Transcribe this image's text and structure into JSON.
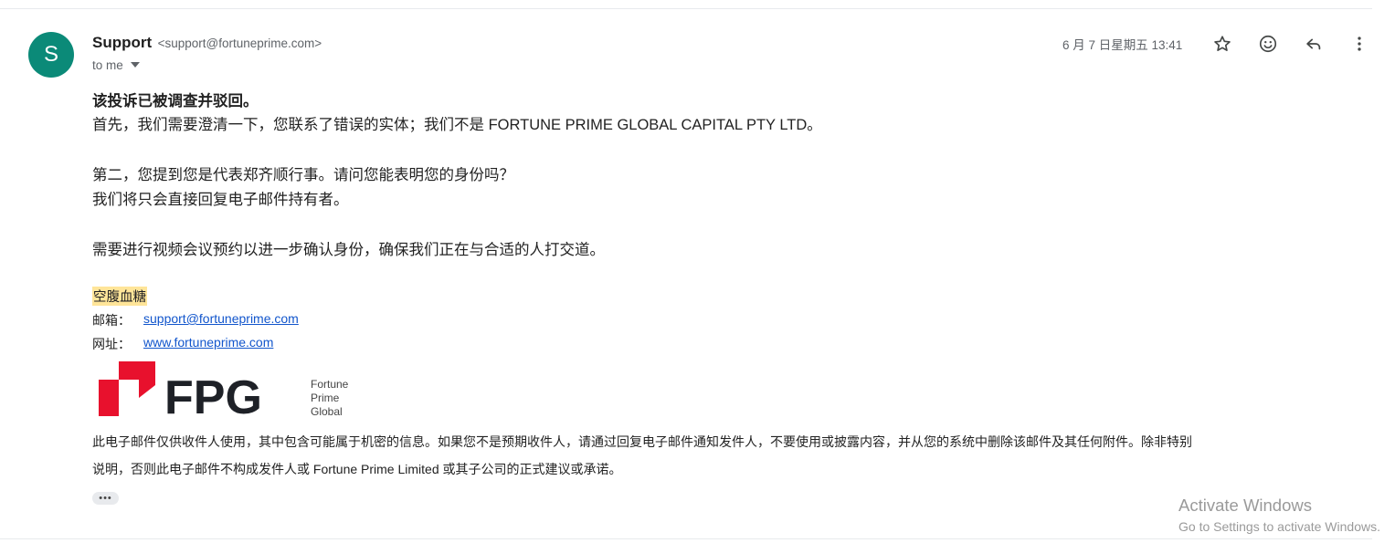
{
  "email": {
    "avatar_letter": "S",
    "sender_name": "Support",
    "sender_email": "<support@fortuneprime.com>",
    "recipient": "to me",
    "date": "6 月 7 日星期五 13:41",
    "body": {
      "line1": "该投诉已被调查并驳回。",
      "line2": "首先，我们需要澄清一下，您联系了错误的实体；我们不是 FORTUNE PRIME GLOBAL CAPITAL PTY LTD。",
      "line3": "第二，您提到您是代表郑齐顺行事。请问您能表明您的身份吗？",
      "line4": "我们将只会直接回复电子邮件持有者。",
      "line5": "需要进行视频会议预约以进一步确认身份，确保我们正在与合适的人打交道。"
    },
    "signature": {
      "name": "空腹血糖",
      "email_label": "邮箱：",
      "email_link": "support@fortuneprime.com",
      "web_label": "网址：",
      "web_link": "www.fortuneprime.com"
    },
    "logo": {
      "wordmark": "FPG",
      "tagline": [
        "Fortune",
        "Prime",
        "Global"
      ],
      "brand_red": "#e8112d",
      "brand_dark": "#1e2127"
    },
    "disclaimer": {
      "line1": "此电子邮件仅供收件人使用，其中包含可能属于机密的信息。如果您不是预期收件人，请通过回复电子邮件通知发件人，不要使用或披露内容，并从您的系统中删除该邮件及其任何附件。除非特别",
      "line2": "说明，否则此电子邮件不构成发件人或 Fortune Prime Limited 或其子公司的正式建议或承诺。"
    },
    "trimmed_content": "•••"
  },
  "toolbar_icons": [
    "star-icon",
    "emoji-icon",
    "reply-icon",
    "more-vert-icon"
  ],
  "watermark": {
    "title": "Activate Windows",
    "subtitle": "Go to Settings to activate Windows."
  },
  "colors": {
    "avatar": "#0b8a78",
    "link": "#1155cc",
    "highlight": "#ffe599",
    "secondary_text": "#5f6368"
  }
}
